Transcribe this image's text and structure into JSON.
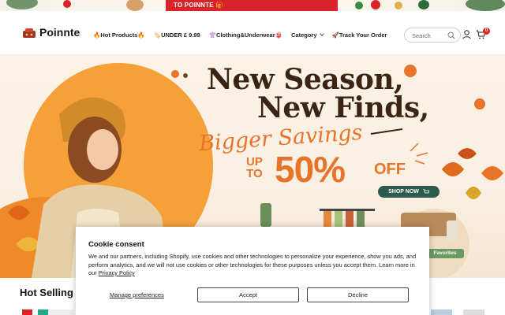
{
  "promo": {
    "text": "TO POINNTE 🎁"
  },
  "header": {
    "logo_text": "Poinnte",
    "nav": [
      {
        "label": "🔥Hot Products🔥"
      },
      {
        "label": "🏷️UNDER £ 9.99"
      },
      {
        "label": "👚Clothing&Underwear👙"
      },
      {
        "label": "Category"
      },
      {
        "label": "🚀Track Your Order"
      }
    ],
    "search_placeholder": "Search",
    "cart_count": "0",
    "icons": [
      "search-icon",
      "user-icon",
      "cart-icon",
      "chevron-down-icon"
    ]
  },
  "banner": {
    "line1": "New Season,",
    "line2": "New Finds,",
    "script": "Bigger Savings",
    "upto_top": "UP",
    "upto_bottom": "TO",
    "percent": "50%",
    "off": "OFF",
    "shop_now": "SHOP NOW",
    "favorites": "Favorites",
    "colors": {
      "accent": "#e8742b",
      "headline": "#3b2414",
      "button": "#2c5a4b"
    }
  },
  "cookie": {
    "title": "Cookie consent",
    "body": "We and our partners, including Shopify, use cookies and other technologies to personalize your experience, show you ads, and perform analytics, and we will not use cookies or other technologies for these purposes unless you accept them. Learn more in our",
    "policy_link": "Privacy Policy",
    "manage": "Manage preferences",
    "accept": "Accept",
    "decline": "Decline"
  },
  "section": {
    "title": "Hot Selling"
  }
}
